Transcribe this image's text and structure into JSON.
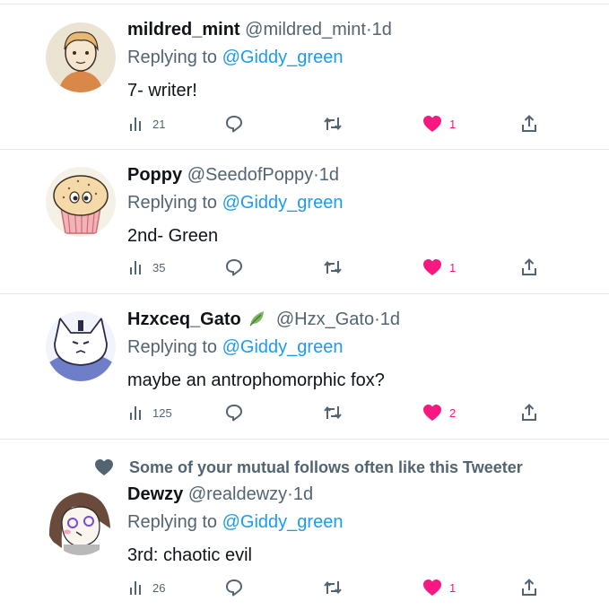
{
  "tweets": [
    {
      "name": "mildred_mint",
      "handle": "@mildred_mint",
      "dot": "·",
      "time": "1d",
      "reply_prefix": "Replying to ",
      "reply_to": "@Giddy_green",
      "text": "7- writer!",
      "views": "21",
      "likes": "1",
      "verified_badge": false
    },
    {
      "name": "Poppy",
      "handle": "@SeedofPoppy",
      "dot": "·",
      "time": "1d",
      "reply_prefix": "Replying to ",
      "reply_to": "@Giddy_green",
      "text": "2nd- Green",
      "views": "35",
      "likes": "1",
      "verified_badge": false
    },
    {
      "name": "Hzxceq_Gato",
      "handle": "@Hzx_Gato",
      "dot": "·",
      "time": "1d",
      "reply_prefix": "Replying to ",
      "reply_to": "@Giddy_green",
      "text": "maybe an antrophomorphic fox?",
      "views": "125",
      "likes": "2",
      "verified_badge": "leaf-emoji"
    },
    {
      "name": "Dewzy",
      "handle": "@realdewzy",
      "dot": "·",
      "time": "1d",
      "reply_prefix": "Replying to ",
      "reply_to": "@Giddy_green",
      "text": "3rd: chaotic evil",
      "views": "26",
      "likes": "1",
      "verified_badge": false
    }
  ],
  "social_context": "Some of your mutual follows often like this Tweeter",
  "icons": [
    "views-icon",
    "reply-icon",
    "retweet-icon",
    "heart-icon",
    "share-icon",
    "leaf-icon"
  ],
  "colors": {
    "name": "#0f1419",
    "secondary": "#536471",
    "mention": "#1d9bf0",
    "like": "#f91880",
    "divider": "#e6e9eb"
  }
}
